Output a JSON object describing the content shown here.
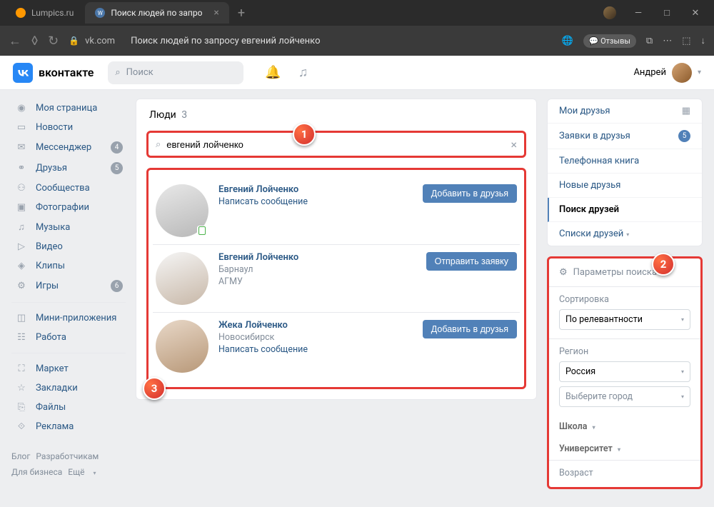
{
  "browser": {
    "tab1": "Lumpics.ru",
    "tab2": "Поиск людей по запро",
    "url": "vk.com",
    "page_title": "Поиск людей по запросу евгений лойченко",
    "reviews": "Отзывы"
  },
  "header": {
    "logo_text": "вконтакте",
    "search_placeholder": "Поиск",
    "user_name": "Андрей"
  },
  "leftnav": {
    "items": [
      {
        "label": "Моя страница",
        "icon": "◉"
      },
      {
        "label": "Новости",
        "icon": "▭"
      },
      {
        "label": "Мессенджер",
        "icon": "✉",
        "badge": "4"
      },
      {
        "label": "Друзья",
        "icon": "⚭",
        "badge": "5"
      },
      {
        "label": "Сообщества",
        "icon": "⚇"
      },
      {
        "label": "Фотографии",
        "icon": "▣"
      },
      {
        "label": "Музыка",
        "icon": "♫"
      },
      {
        "label": "Видео",
        "icon": "▷"
      },
      {
        "label": "Клипы",
        "icon": "◈"
      },
      {
        "label": "Игры",
        "icon": "⚙",
        "badge": "6"
      }
    ],
    "items2": [
      {
        "label": "Мини-приложения",
        "icon": "◫"
      },
      {
        "label": "Работа",
        "icon": "☷"
      }
    ],
    "items3": [
      {
        "label": "Маркет",
        "icon": "⛶"
      },
      {
        "label": "Закладки",
        "icon": "☆"
      },
      {
        "label": "Файлы",
        "icon": "⎘"
      },
      {
        "label": "Реклама",
        "icon": "⟐"
      }
    ],
    "footer": [
      "Блог",
      "Разработчикам",
      "Для бизнеса",
      "Ещё"
    ]
  },
  "main": {
    "heading": "Люди",
    "count": "3",
    "search_value": "евгений лойченко",
    "people": [
      {
        "name": "Евгений Лойченко",
        "line1": "",
        "line2": "",
        "link": "Написать сообщение",
        "btn": "Добавить в друзья",
        "mobile": true
      },
      {
        "name": "Евгений Лойченко",
        "line1": "Барнаул",
        "line2": "АГМУ",
        "link": "",
        "btn": "Отправить заявку"
      },
      {
        "name": "Жека Лойченко",
        "line1": "Новосибирск",
        "line2": "",
        "link": "Написать сообщение",
        "btn": "Добавить в друзья"
      }
    ]
  },
  "rnav": {
    "items": [
      {
        "label": "Мои друзья",
        "icon_right": true
      },
      {
        "label": "Заявки в друзья",
        "badge": "5"
      },
      {
        "label": "Телефонная книга"
      },
      {
        "label": "Новые друзья"
      },
      {
        "label": "Поиск друзей",
        "active": true
      },
      {
        "label": "Списки друзей",
        "chev": true
      }
    ]
  },
  "filters": {
    "header": "Параметры поиска",
    "sort_label": "Сортировка",
    "sort_value": "По релевантности",
    "region_label": "Регион",
    "country": "Россия",
    "city_placeholder": "Выберите город",
    "school": "Школа",
    "university": "Университет",
    "age": "Возраст"
  },
  "markers": {
    "m1": "1",
    "m2": "2",
    "m3": "3"
  }
}
